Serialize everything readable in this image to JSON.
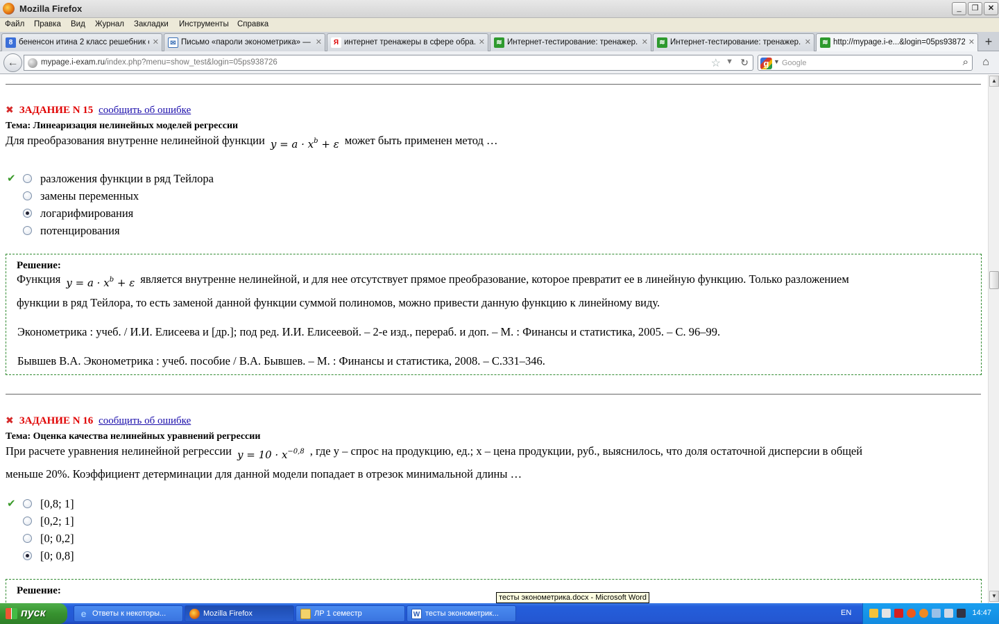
{
  "window": {
    "title": "Mozilla Firefox"
  },
  "menu": [
    "Файл",
    "Правка",
    "Вид",
    "Журнал",
    "Закладки",
    "Инструменты",
    "Справка"
  ],
  "tabs": [
    {
      "label": "бененсон итина 2 класс решебник с...",
      "icon": "google-favicon"
    },
    {
      "label": "Письмо «пароли эконометрика» — ...",
      "icon": "mail-favicon"
    },
    {
      "label": "интернет тренажеры в сфере обра...",
      "icon": "yandex-favicon"
    },
    {
      "label": "Интернет-тестирование: тренажер...",
      "icon": "i-exam-favicon"
    },
    {
      "label": "Интернет-тестирование: тренажер...",
      "icon": "i-exam-favicon"
    },
    {
      "label": "http://mypage.i-e...&login=05ps938726",
      "icon": "i-exam-favicon"
    }
  ],
  "navbar": {
    "url_host": "mypage.i-exam.ru",
    "url_path": "/index.php?menu=show_test&login=05ps938726",
    "search_placeholder": "Google"
  },
  "content": {
    "task15": {
      "title": "ЗАДАНИЕ N 15",
      "report_link": "сообщить об ошибке",
      "topic_label": "Тема:",
      "topic": "Линеаризация нелинейных моделей регрессии",
      "question_before": "Для преобразования внутренне нелинейной функции",
      "question_after": "может быть применен метод …",
      "formula": "y = a · x",
      "formula_sup": "b",
      "formula_tail": " + ε",
      "options": [
        {
          "text": "разложения функции в ряд Тейлора",
          "correct": true,
          "selected": false
        },
        {
          "text": "замены переменных",
          "correct": false,
          "selected": false
        },
        {
          "text": "логарифмирования",
          "correct": false,
          "selected": true
        },
        {
          "text": "потенцирования",
          "correct": false,
          "selected": false
        }
      ],
      "solution": {
        "title": "Решение:",
        "line1_before": "Функция",
        "line1_after": "является внутренне нелинейной, и для нее отсутствует прямое преобразование, которое превратит ее в линейную функцию. Только разложением",
        "line2": "функции в ряд Тейлора, то есть заменой данной функции суммой полиномов, можно привести данную функцию к линейному виду.",
        "ref1": "Эконометрика : учеб. / И.И. Елисеева и [др.]; под ред. И.И. Елисеевой. – 2-е изд., перераб. и доп. – М. : Финансы и статистика, 2005. – С. 96–99.",
        "ref2": "Бывшев В.А. Эконометрика : учеб. пособие / В.А. Бывшев. –  М. : Финансы и статистика, 2008. – С.331–346."
      }
    },
    "task16": {
      "title": "ЗАДАНИЕ N 16",
      "report_link": "сообщить об ошибке",
      "topic_label": "Тема:",
      "topic": "Оценка качества нелинейных уравнений регрессии",
      "question_line1_before": "При расчете уравнения нелинейной регрессии",
      "formula": "y = 10 · x",
      "formula_sup": "−0,8",
      "question_line1_after": ", где y – спрос на продукцию, ед.; x – цена продукции, руб., выяснилось, что доля остаточной дисперсии в общей",
      "question_line2": "меньше 20%. Коэффициент детерминации для данной модели попадает в отрезок минимальной длины …",
      "options": [
        {
          "text": "[0,8; 1]",
          "correct": true,
          "selected": false
        },
        {
          "text": "[0,2; 1]",
          "correct": false,
          "selected": false
        },
        {
          "text": "[0; 0,2]",
          "correct": false,
          "selected": false
        },
        {
          "text": "[0; 0,8]",
          "correct": false,
          "selected": true
        }
      ],
      "solution_title": "Решение:"
    }
  },
  "tooltip": "тесты эконометрика.docx - Microsoft Word",
  "taskbar": {
    "start": "пуск",
    "tasks": [
      {
        "label": "Ответы к некоторы...",
        "icon": "ie-icon"
      },
      {
        "label": "Mozilla Firefox",
        "icon": "firefox-icon"
      },
      {
        "label": "ЛР 1 семестр",
        "icon": "folder-icon"
      },
      {
        "label": "тесты эконометрик...",
        "icon": "word-icon"
      }
    ],
    "lang": "EN",
    "clock": "14:47"
  }
}
